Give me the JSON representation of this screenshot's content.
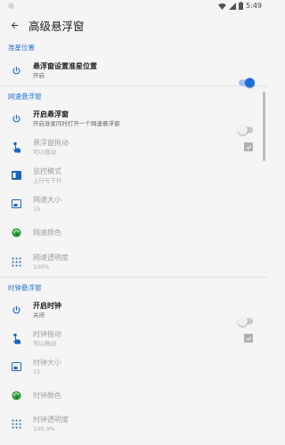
{
  "status_bar": {
    "time": "5:49"
  },
  "app_bar": {
    "title": "高级悬浮窗"
  },
  "sections": {
    "position": {
      "header": "准星位置",
      "rows": {
        "set_position": {
          "title": "悬浮窗设置准星位置",
          "summary": "开启",
          "switch_on": true
        }
      }
    },
    "speed": {
      "header": "网速悬浮窗",
      "rows": {
        "enable": {
          "title": "开启悬浮窗",
          "summary": "开启准星同时打开一个网速悬浮窗",
          "switch_on": false
        },
        "drag": {
          "title": "悬浮窗拖动",
          "summary": "可以拖动",
          "checked": true
        },
        "monitor_mode": {
          "title": "监控模式",
          "summary": "上行与下行"
        },
        "speed_size": {
          "title": "网速大小",
          "summary": "15"
        },
        "speed_color": {
          "title": "网速颜色"
        },
        "speed_opacity": {
          "title": "网速透明度",
          "summary": "100%"
        }
      }
    },
    "clock": {
      "header": "时钟悬浮窗",
      "rows": {
        "enable": {
          "title": "开启时钟",
          "summary": "关闭",
          "switch_on": false
        },
        "drag": {
          "title": "时钟拖动",
          "summary": "可以拖动",
          "checked": true
        },
        "clock_size": {
          "title": "时钟大小",
          "summary": "15"
        },
        "clock_color": {
          "title": "时钟颜色"
        },
        "clock_opacity": {
          "title": "时钟透明度",
          "summary": "100.0%"
        }
      }
    }
  },
  "colors": {
    "accent": "#1e6fd9",
    "icon_blue": "#1565c0",
    "palette_green": "#2e9e3a"
  }
}
